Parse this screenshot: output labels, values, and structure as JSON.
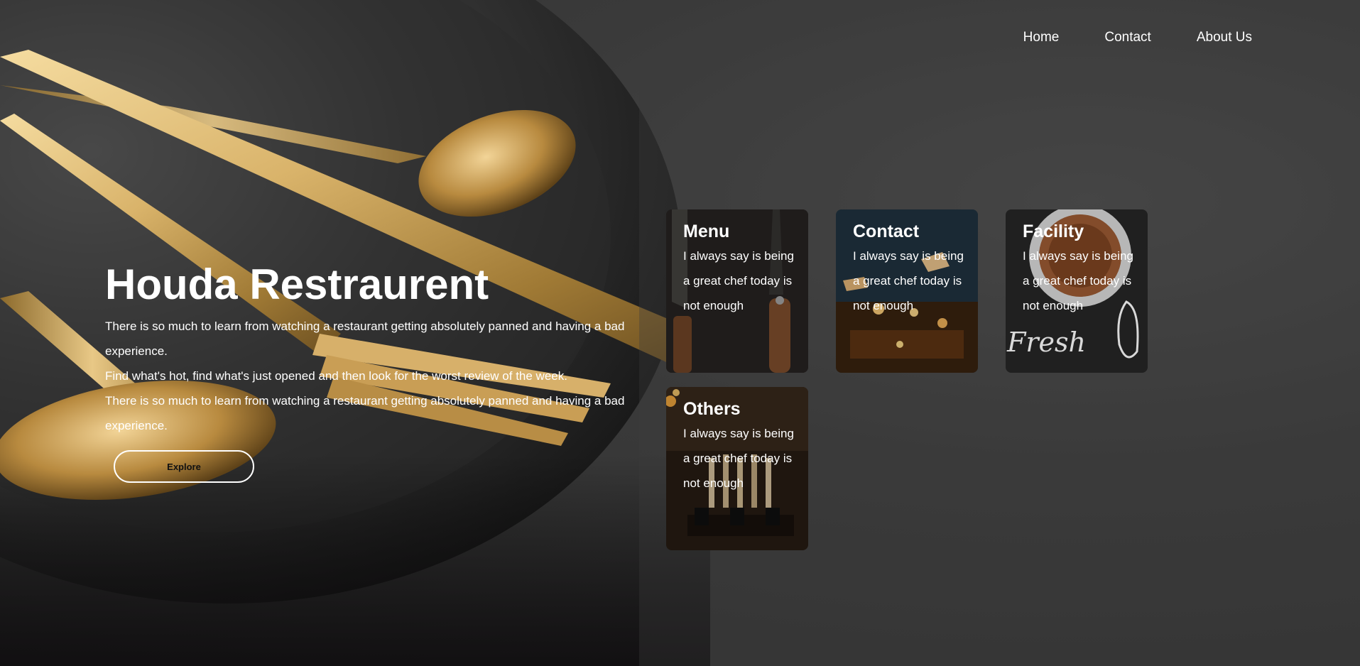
{
  "nav": {
    "items": [
      {
        "label": "Home"
      },
      {
        "label": "Contact"
      },
      {
        "label": "About Us"
      }
    ]
  },
  "hero": {
    "title": "Houda Restraurent",
    "lines": [
      "There is so much to learn from watching a restaurant getting absolutely panned and having a bad experience.",
      "Find what's hot, find what's just opened and then look for the worst review of the week.",
      "There is so much to learn from watching a restaurant getting absolutely panned and having a bad experience."
    ],
    "explore_label": "Explore"
  },
  "cards": [
    {
      "title": "Menu",
      "text": "I always say is being a great chef today is not enough"
    },
    {
      "title": "Contact",
      "text": "I always say is being a great chef today is not enough"
    },
    {
      "title": "Facility",
      "text": "I always say is being a great chef today is not enough",
      "decor_text": "Fresh"
    },
    {
      "title": "Others",
      "text": "I always say is being a great chef today is not enough"
    }
  ],
  "colors": {
    "background": "#3a3a3a",
    "text": "#ffffff",
    "gold": "#c9a14a"
  }
}
